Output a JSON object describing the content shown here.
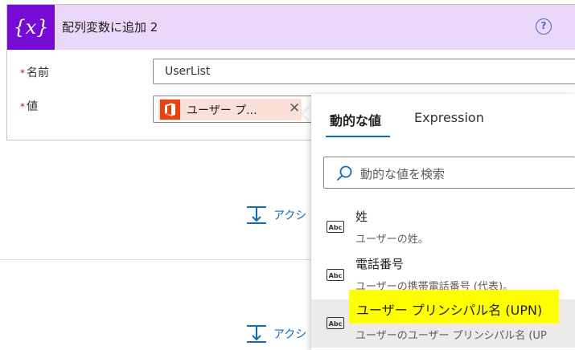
{
  "card": {
    "title": "配列変数に追加 2",
    "icon_text": "{x}",
    "name_label": "名前",
    "name_value": "UserList",
    "value_label": "値",
    "token_label": "ユーザー プ..."
  },
  "add_action": {
    "label": "アクシ"
  },
  "flyout": {
    "tabs": [
      "動的な値",
      "Expression"
    ],
    "search_placeholder": "動的な値を検索",
    "items": [
      {
        "title": "姓",
        "desc": "ユーザーの姓。"
      },
      {
        "title": "電話番号",
        "desc": "ユーザーの携帯電話番号 (代表)。"
      },
      {
        "title": "ユーザー プリンシパル名 (UPN)",
        "desc": "ユーザーのユーザー プリンシパル名 (UP"
      }
    ]
  },
  "icons": {
    "variable": "variable-icon",
    "help": "help-icon",
    "office": "office-icon",
    "close": "close-icon",
    "insert": "insert-step-icon",
    "search": "search-icon",
    "abc": "text-type-icon"
  },
  "colors": {
    "header_bg": "#ead7f9",
    "variable_icon_bg": "#770bd6",
    "token_bg": "#fbe0d7",
    "office_icon_bg": "#e5420f",
    "accent": "#0f6cbd",
    "highlight": "#ffff00"
  }
}
